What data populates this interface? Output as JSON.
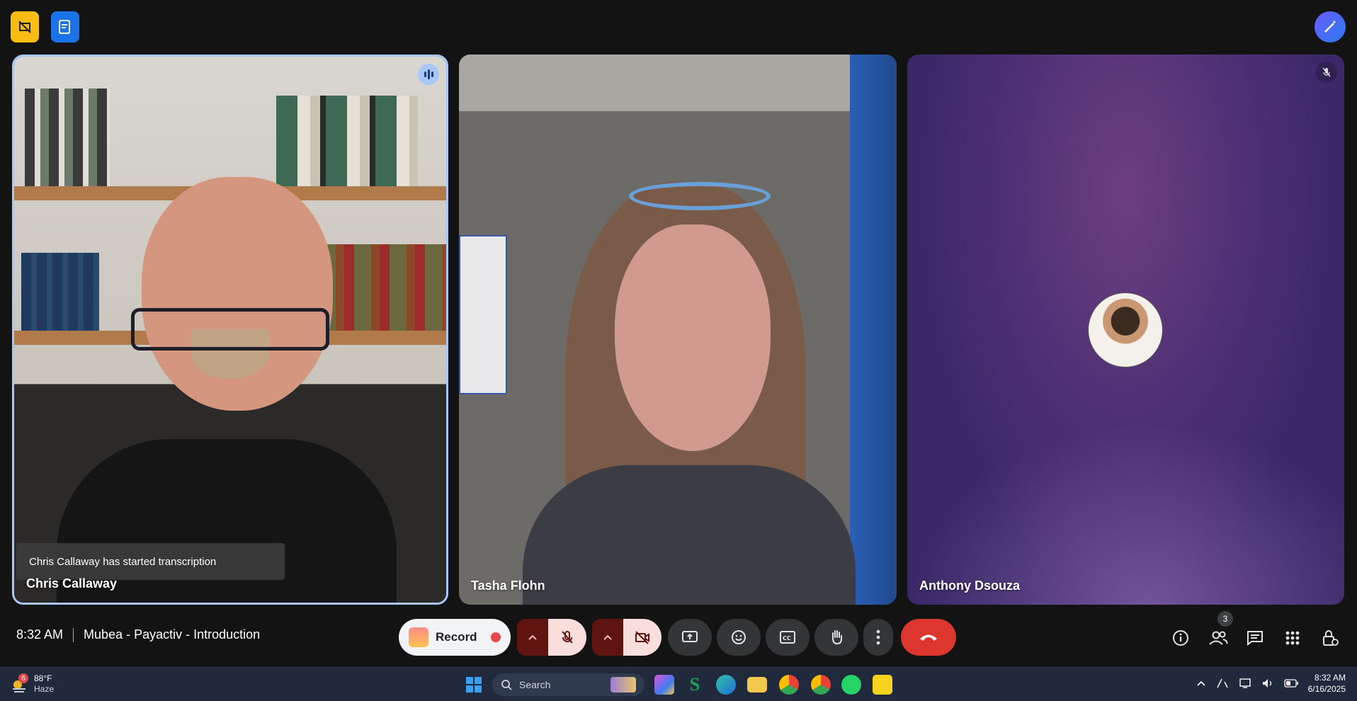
{
  "meeting": {
    "time": "8:32 AM",
    "title": "Mubea - Payactiv - Introduction"
  },
  "participants": [
    {
      "name": "Chris Callaway",
      "speaking": true
    },
    {
      "name": "Tasha Flohn",
      "speaking": false
    },
    {
      "name": "Anthony Dsouza",
      "muted": true
    }
  ],
  "notification": {
    "text": "Chris Callaway has started transcription"
  },
  "controls": {
    "record_label": "Record",
    "people_count": "3",
    "icons": [
      "caret-up-icon",
      "mic-off-icon",
      "camera-off-icon",
      "present-icon",
      "emoji-icon",
      "captions-icon",
      "raise-hand-icon",
      "more-icon",
      "end-call-icon",
      "info-icon",
      "people-icon",
      "chat-icon",
      "apps-icon",
      "host-controls-icon"
    ]
  },
  "colors": {
    "speaking_border": "#a8c7fa",
    "end_call": "#dc362e",
    "muted_bg": "#f9dedc",
    "muted_caret": "#601410"
  },
  "taskbar": {
    "weather_badge": "6",
    "temperature": "88°F",
    "condition": "Haze",
    "search_placeholder": "Search",
    "time": "8:32 AM",
    "date": "6/16/2025"
  }
}
